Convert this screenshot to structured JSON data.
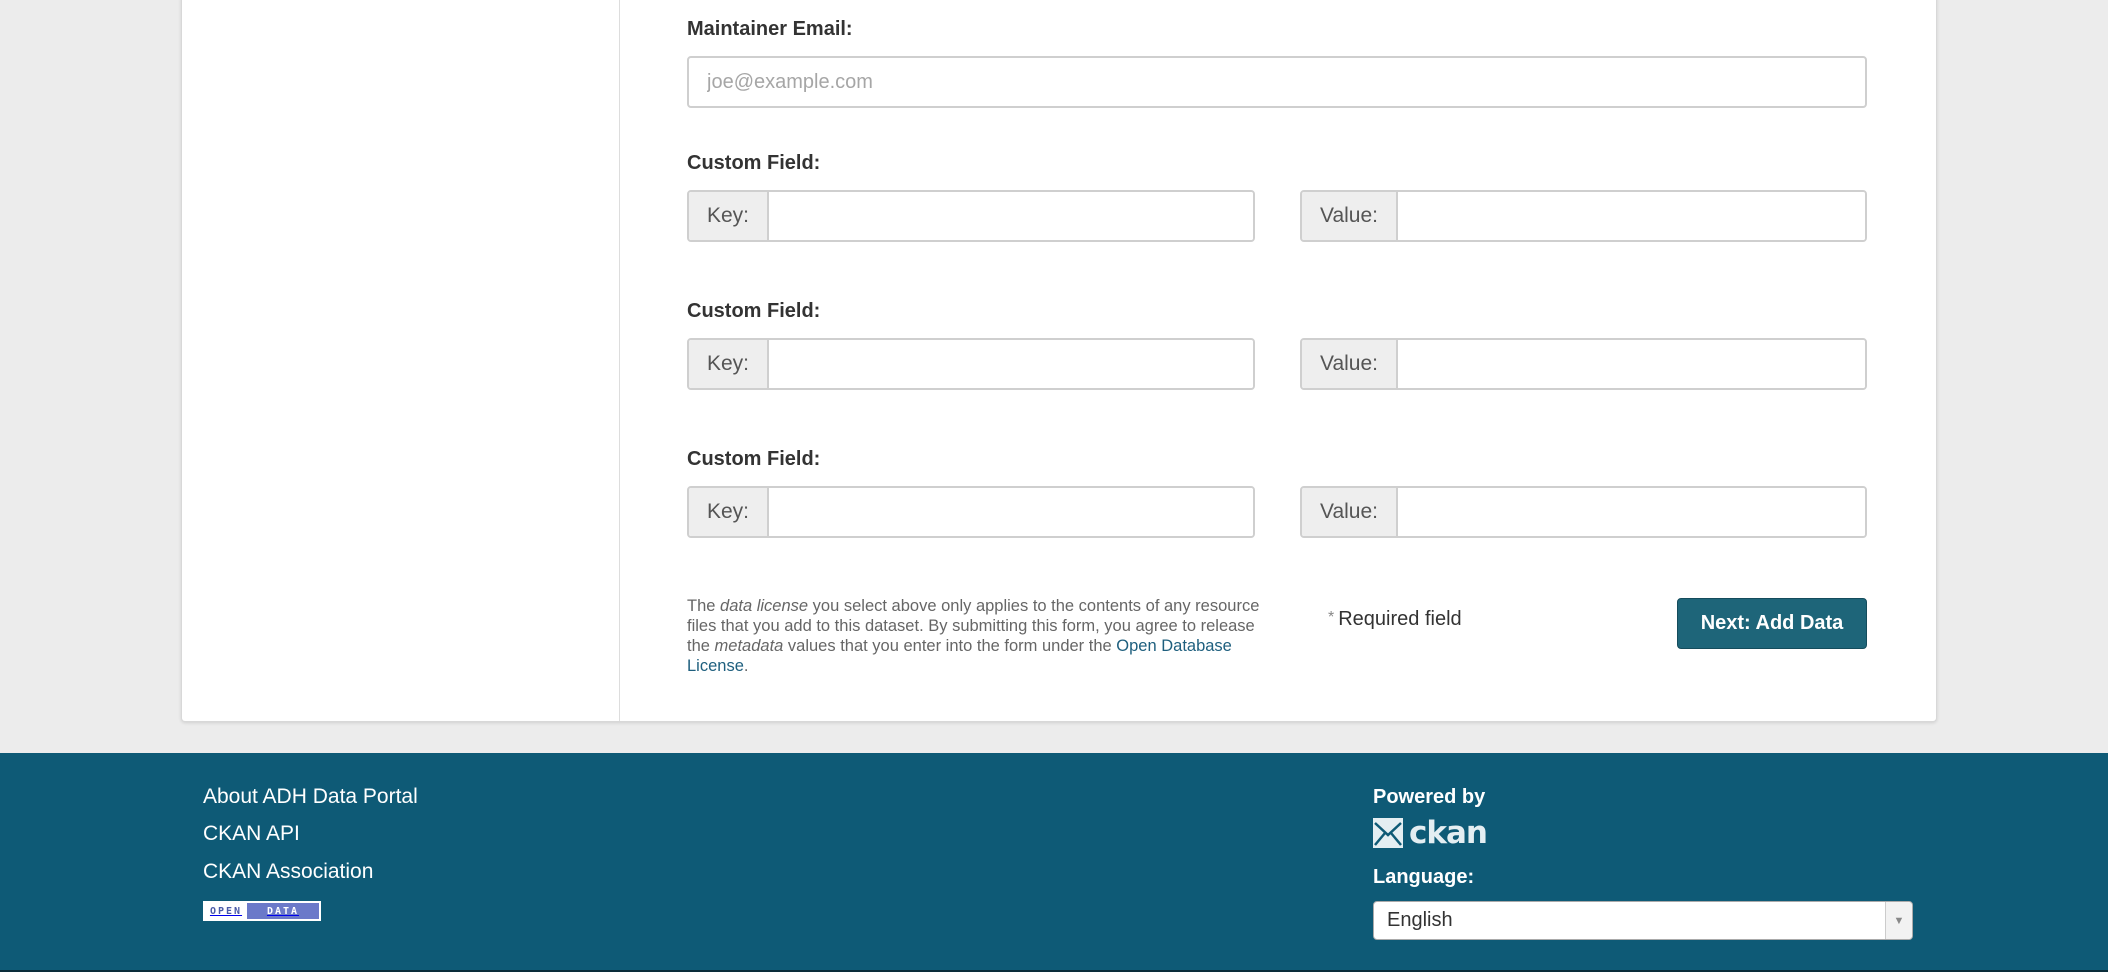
{
  "form": {
    "maintainer_email": {
      "label": "Maintainer Email:",
      "value": "",
      "placeholder": "joe@example.com"
    },
    "custom_fields": [
      {
        "label": "Custom Field:",
        "key_label": "Key:",
        "key_value": "",
        "value_label": "Value:",
        "value_value": ""
      },
      {
        "label": "Custom Field:",
        "key_label": "Key:",
        "key_value": "",
        "value_label": "Value:",
        "value_value": ""
      },
      {
        "label": "Custom Field:",
        "key_label": "Key:",
        "key_value": "",
        "value_label": "Value:",
        "value_value": ""
      }
    ],
    "license_note": {
      "part1": "The ",
      "em1": "data license",
      "part2": " you select above only applies to the contents of any resource files that you add to this dataset. By submitting this form, you agree to release the ",
      "em2": "metadata",
      "part3": " values that you enter into the form under the ",
      "link_text": "Open Database License",
      "part4": "."
    },
    "required_star": "*",
    "required_text": "Required field",
    "submit_label": "Next: Add Data"
  },
  "footer": {
    "links": [
      "About ADH Data Portal",
      "CKAN API",
      "CKAN Association"
    ],
    "badge_open": "OPEN",
    "badge_data": "DATA",
    "powered_by": "Powered by",
    "ckan_logo_text": "ckan",
    "ckan_logo_icon": "ckan-envelope-icon",
    "language_label": "Language:",
    "language_value": "English"
  },
  "colors": {
    "footer_bg": "#0e5a76",
    "primary_button": "#1e6579",
    "link": "#1e5f7e",
    "page_bg": "#ececec"
  }
}
